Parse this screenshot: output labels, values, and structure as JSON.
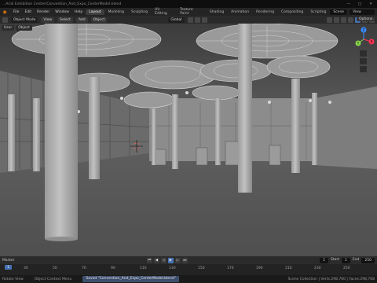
{
  "titlebar": {
    "title": "...Arial Exhibition Center\\Convention_And_Expo_CenterModel.blend",
    "buttons": [
      "—",
      "□",
      "✕"
    ]
  },
  "menubar": {
    "logo_icon": "blender-logo-icon",
    "menus": [
      "File",
      "Edit",
      "Render",
      "Window",
      "Help"
    ],
    "workspaces": [
      "Layout",
      "Modeling",
      "Sculpting",
      "UV Editing",
      "Texture Paint",
      "Shading",
      "Animation",
      "Rendering",
      "Compositing",
      "Scripting"
    ],
    "active_workspace": "Layout",
    "scene_name": "Scene",
    "view_layer": "View Layer"
  },
  "viewport_header": {
    "mode": "Object Mode",
    "view": "View",
    "select": "Select",
    "add": "Add",
    "object": "Object",
    "transform": "Global",
    "options": "Options"
  },
  "viewport_tools": [
    "User",
    "Object"
  ],
  "gizmo": {
    "labels": [
      "Z",
      "Y",
      "X"
    ],
    "colors": [
      "#3b8cff",
      "#88d44b",
      "#ff3352"
    ]
  },
  "timeline": {
    "label": "Marker",
    "current_frame": "1",
    "start_label": "Start",
    "start": "1",
    "end_label": "End",
    "end": "250",
    "ruler": [
      "30",
      "50",
      "70",
      "90",
      "110",
      "130",
      "150",
      "170",
      "190",
      "210",
      "230",
      "250"
    ]
  },
  "statusbar": {
    "left": "Rotate View",
    "mid": "Object Context Menu",
    "saved": "Saved \"Convention_And_Expo_CenterModel.blend\"",
    "right": "Scene Collection | Verts:298,760 | Faces:298,768"
  },
  "colors": {
    "accent": "#4772b3",
    "orange": "#e87d0d",
    "floor": "#555555",
    "wall": "#8a8a8a"
  }
}
